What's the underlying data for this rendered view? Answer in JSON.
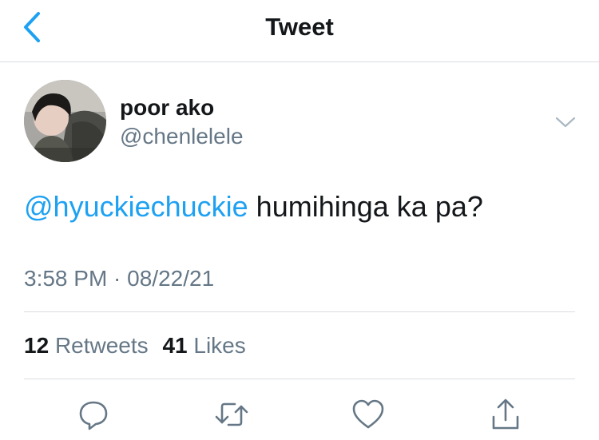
{
  "nav": {
    "title": "Tweet",
    "back_icon": "chevron-left-icon"
  },
  "colors": {
    "accent": "#1da1f2",
    "text": "#14171a",
    "secondary": "#657786",
    "divider": "#d9dde1"
  },
  "tweet": {
    "author": {
      "display_name": "poor ako",
      "handle": "@chenlelele"
    },
    "mention": "@hyuckiechuckie",
    "text": " humihinga ka pa?",
    "time": "3:58 PM",
    "separator": " · ",
    "date": "08/22/21"
  },
  "stats": {
    "retweets_count": "12",
    "retweets_label": "Retweets",
    "likes_count": "41",
    "likes_label": "Likes"
  },
  "actions": {
    "icons": [
      "reply-icon",
      "retweet-icon",
      "like-icon",
      "share-icon"
    ]
  }
}
